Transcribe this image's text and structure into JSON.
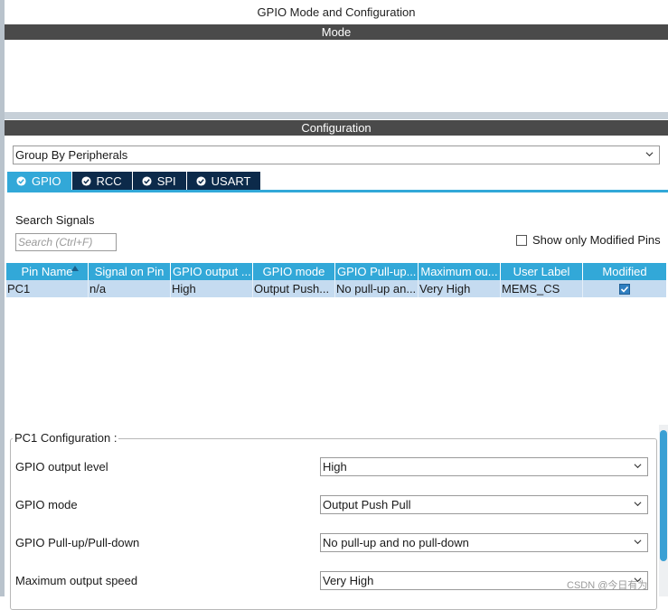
{
  "window": {
    "title": "GPIO Mode and Configuration"
  },
  "sections": {
    "mode": "Mode",
    "configuration": "Configuration"
  },
  "group_by": {
    "selected": "Group By Peripherals"
  },
  "tabs": [
    {
      "label": "GPIO",
      "active": true
    },
    {
      "label": "RCC",
      "active": false
    },
    {
      "label": "SPI",
      "active": false
    },
    {
      "label": "USART",
      "active": false
    }
  ],
  "search": {
    "label": "Search Signals",
    "placeholder": "Search (Ctrl+F)"
  },
  "show_modified": {
    "label": "Show only Modified Pins",
    "checked": false
  },
  "table": {
    "headers": [
      "Pin Name",
      "Signal on Pin",
      "GPIO output ...",
      "GPIO mode",
      "GPIO Pull-up...",
      "Maximum ou...",
      "User Label",
      "Modified"
    ],
    "rows": [
      {
        "pin_name": "PC1",
        "signal": "n/a",
        "output_level": "High",
        "mode": "Output Push...",
        "pull": "No pull-up an...",
        "speed": "Very High",
        "user_label": "MEMS_CS",
        "modified": true
      }
    ]
  },
  "pin_config": {
    "legend": "PC1 Configuration :",
    "fields": [
      {
        "label": "GPIO output level",
        "value": "High"
      },
      {
        "label": "GPIO mode",
        "value": "Output Push Pull"
      },
      {
        "label": "GPIO Pull-up/Pull-down",
        "value": "No pull-up and no pull-down"
      },
      {
        "label": "Maximum output speed",
        "value": "Very High"
      }
    ]
  },
  "watermark": "CSDN @今日有为",
  "colors": {
    "accent": "#32a8d8",
    "tab_dark": "#0c2a4a",
    "section_bar": "#4a4a4a",
    "row_selected": "#c5dbf0"
  }
}
